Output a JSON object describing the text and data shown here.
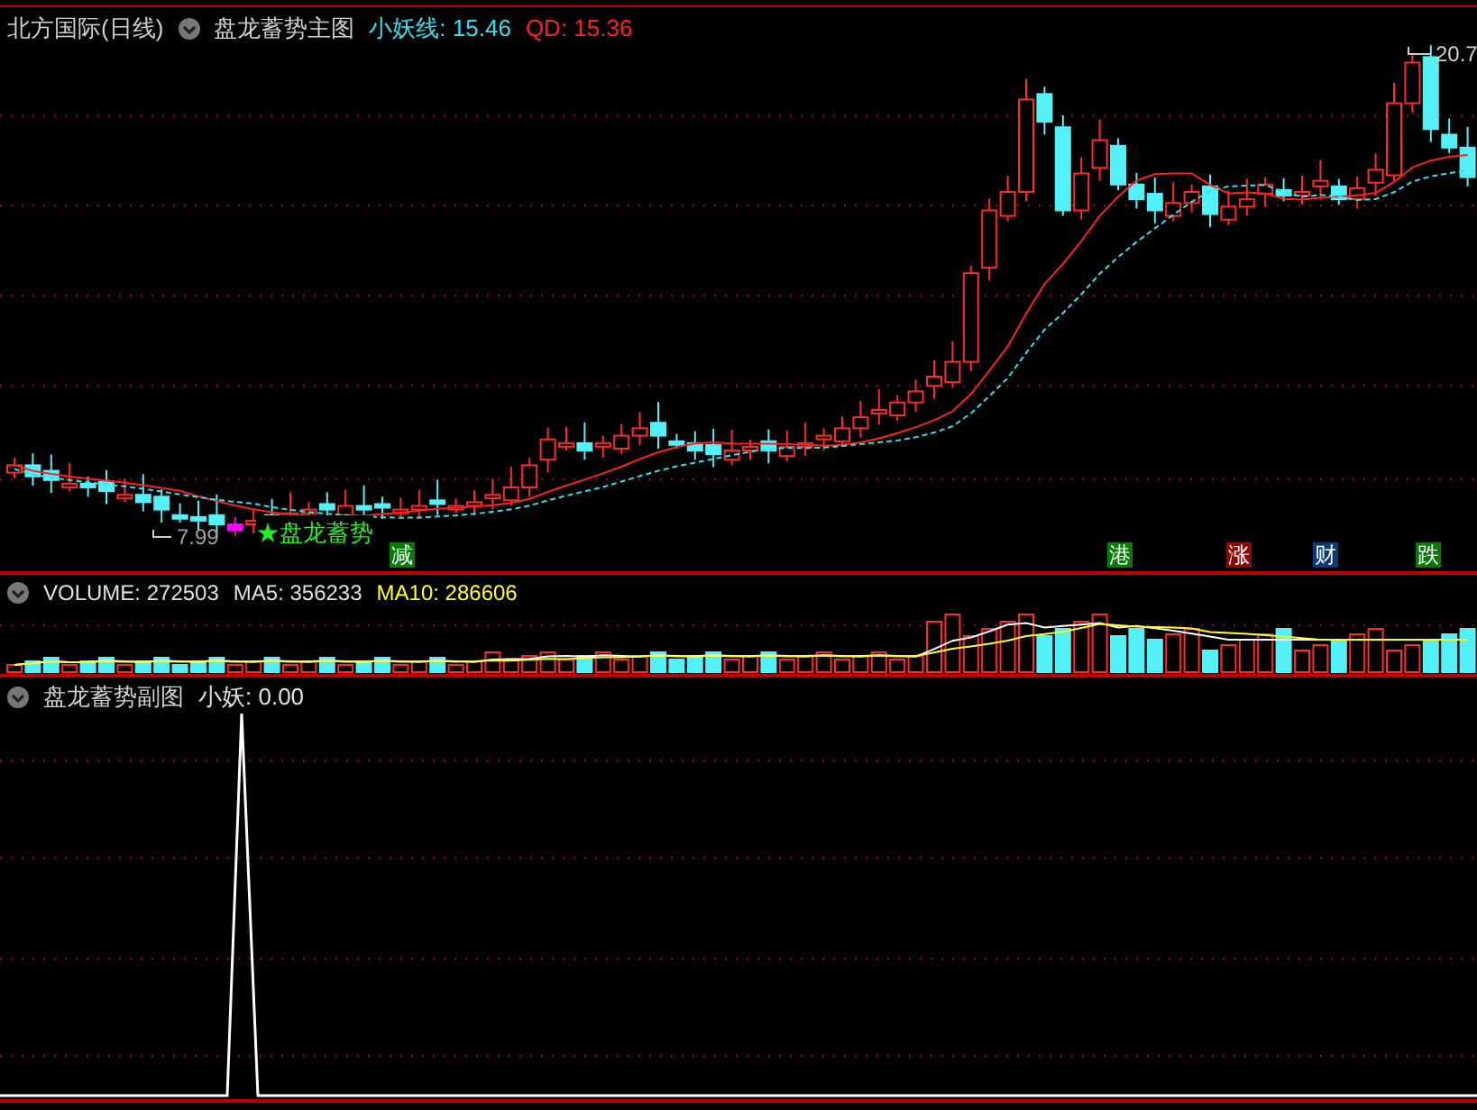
{
  "header": {
    "stock": "北方国际(日线)",
    "indicator": "盘龙蓄势主图",
    "lines": [
      {
        "label": "小妖线: 15.46",
        "color": "#33e0f0"
      },
      {
        "label": "QD: 15.36",
        "color": "#ff2020"
      }
    ]
  },
  "main_chart": {
    "high_label": "20.7",
    "low_label": "7.99",
    "signal_label": "★盘龙蓄势",
    "markers": [
      {
        "label": "减",
        "color": "#0a7a0a"
      },
      {
        "label": "港",
        "color": "#0a7a0a"
      },
      {
        "label": "涨",
        "color": "#8a0a0a"
      },
      {
        "label": "财",
        "color": "#0a3a7a"
      },
      {
        "label": "跌",
        "color": "#0a7a0a"
      }
    ]
  },
  "volume_panel": {
    "readings": [
      {
        "label": "VOLUME: 272503",
        "color": "#e0e0e0"
      },
      {
        "label": "MA5: 356233",
        "color": "#e0e0e0"
      },
      {
        "label": "MA10: 286606",
        "color": "#ffff30"
      }
    ]
  },
  "sub_panel": {
    "indicator": "盘龙蓄势副图",
    "reading": "小妖: 0.00"
  }
}
